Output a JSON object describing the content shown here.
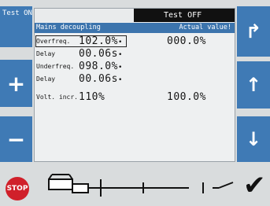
{
  "left_panel": {
    "test_on_label": "Test ON",
    "plus_symbol": "+",
    "minus_symbol": "−"
  },
  "right_panel": {
    "corner_symbol": "↱",
    "up_symbol": "↑",
    "down_symbol": "↓"
  },
  "status": {
    "text": "Test OFF"
  },
  "header": {
    "title": "Mains decoupling",
    "actual_label": "Actual value!"
  },
  "rows": [
    {
      "label": "Overfreq.",
      "value": "102.0%",
      "marker": "•",
      "actual": "000.0%"
    },
    {
      "label": "Delay",
      "value": "00.06s",
      "marker": "•",
      "actual": ""
    },
    {
      "label": "Underfreq.",
      "value": "098.0%",
      "marker": "•",
      "actual": ""
    },
    {
      "label": "Delay",
      "value": "00.06s",
      "marker": "•",
      "actual": ""
    },
    {
      "label": "Volt. incr.",
      "value": "110%",
      "marker": "",
      "actual": "100.0%"
    }
  ],
  "footer": {
    "stop_label": "STOP",
    "confirm_symbol": "✔"
  },
  "colors": {
    "button_blue": "#3f7ab5",
    "header_blue": "#3c74ad",
    "stop_red": "#d0202a",
    "status_black": "#111111"
  },
  "icons": [
    "stop-icon",
    "single-line-diagram-icon",
    "check-icon",
    "plus-icon",
    "minus-icon",
    "up-arrow-icon",
    "down-arrow-icon",
    "corner-arrow-icon"
  ]
}
